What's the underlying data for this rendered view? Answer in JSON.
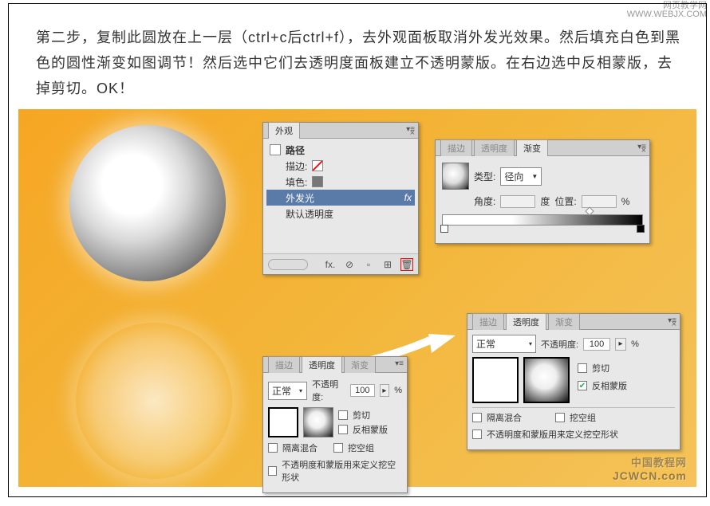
{
  "watermark_top": {
    "line1": "网页教学网",
    "line2": "WWW.WEBJX.COM"
  },
  "watermark_bottom": {
    "cn": "中国教程网",
    "en": "JCWCN.com"
  },
  "instructions": "第二步，复制此圆放在上一层（ctrl+c后ctrl+f），去外观面板取消外发光效果。然后填充白色到黑色的圆性渐变如图调节！然后选中它们去透明度面板建立不透明蒙版。在右边选中反相蒙版，去掉剪切。OK！",
  "appearance": {
    "title": "外观",
    "item_path": "路径",
    "item_stroke": "描边:",
    "item_fill": "填色:",
    "item_glow": "外发光",
    "item_default": "默认透明度",
    "fx": "fx"
  },
  "gradient": {
    "tab_stroke": "描边",
    "tab_trans": "透明度",
    "tab_grad": "渐变",
    "type_label": "类型:",
    "type_value": "径向",
    "angle_label": "角度:",
    "angle_unit": "度",
    "pos_label": "位置:",
    "pos_unit": "%"
  },
  "transparency_sm": {
    "tab_stroke": "描边",
    "tab_trans": "透明度",
    "tab_grad": "渐变",
    "mode": "正常",
    "opacity_label": "不透明度:",
    "opacity_value": "100",
    "pct": "%",
    "clip": "剪切",
    "invert": "反相蒙版",
    "isolate": "隔离混合",
    "knockout": "挖空组",
    "long": "不透明度和蒙版用来定义挖空形状"
  },
  "transparency_lg": {
    "tab_stroke": "描边",
    "tab_trans": "透明度",
    "tab_grad": "渐变",
    "mode": "正常",
    "opacity_label": "不透明度:",
    "opacity_value": "100",
    "pct": "%",
    "clip": "剪切",
    "invert": "反相蒙版",
    "isolate": "隔离混合",
    "knockout": "挖空组",
    "long": "不透明度和蒙版用来定义挖空形状"
  }
}
